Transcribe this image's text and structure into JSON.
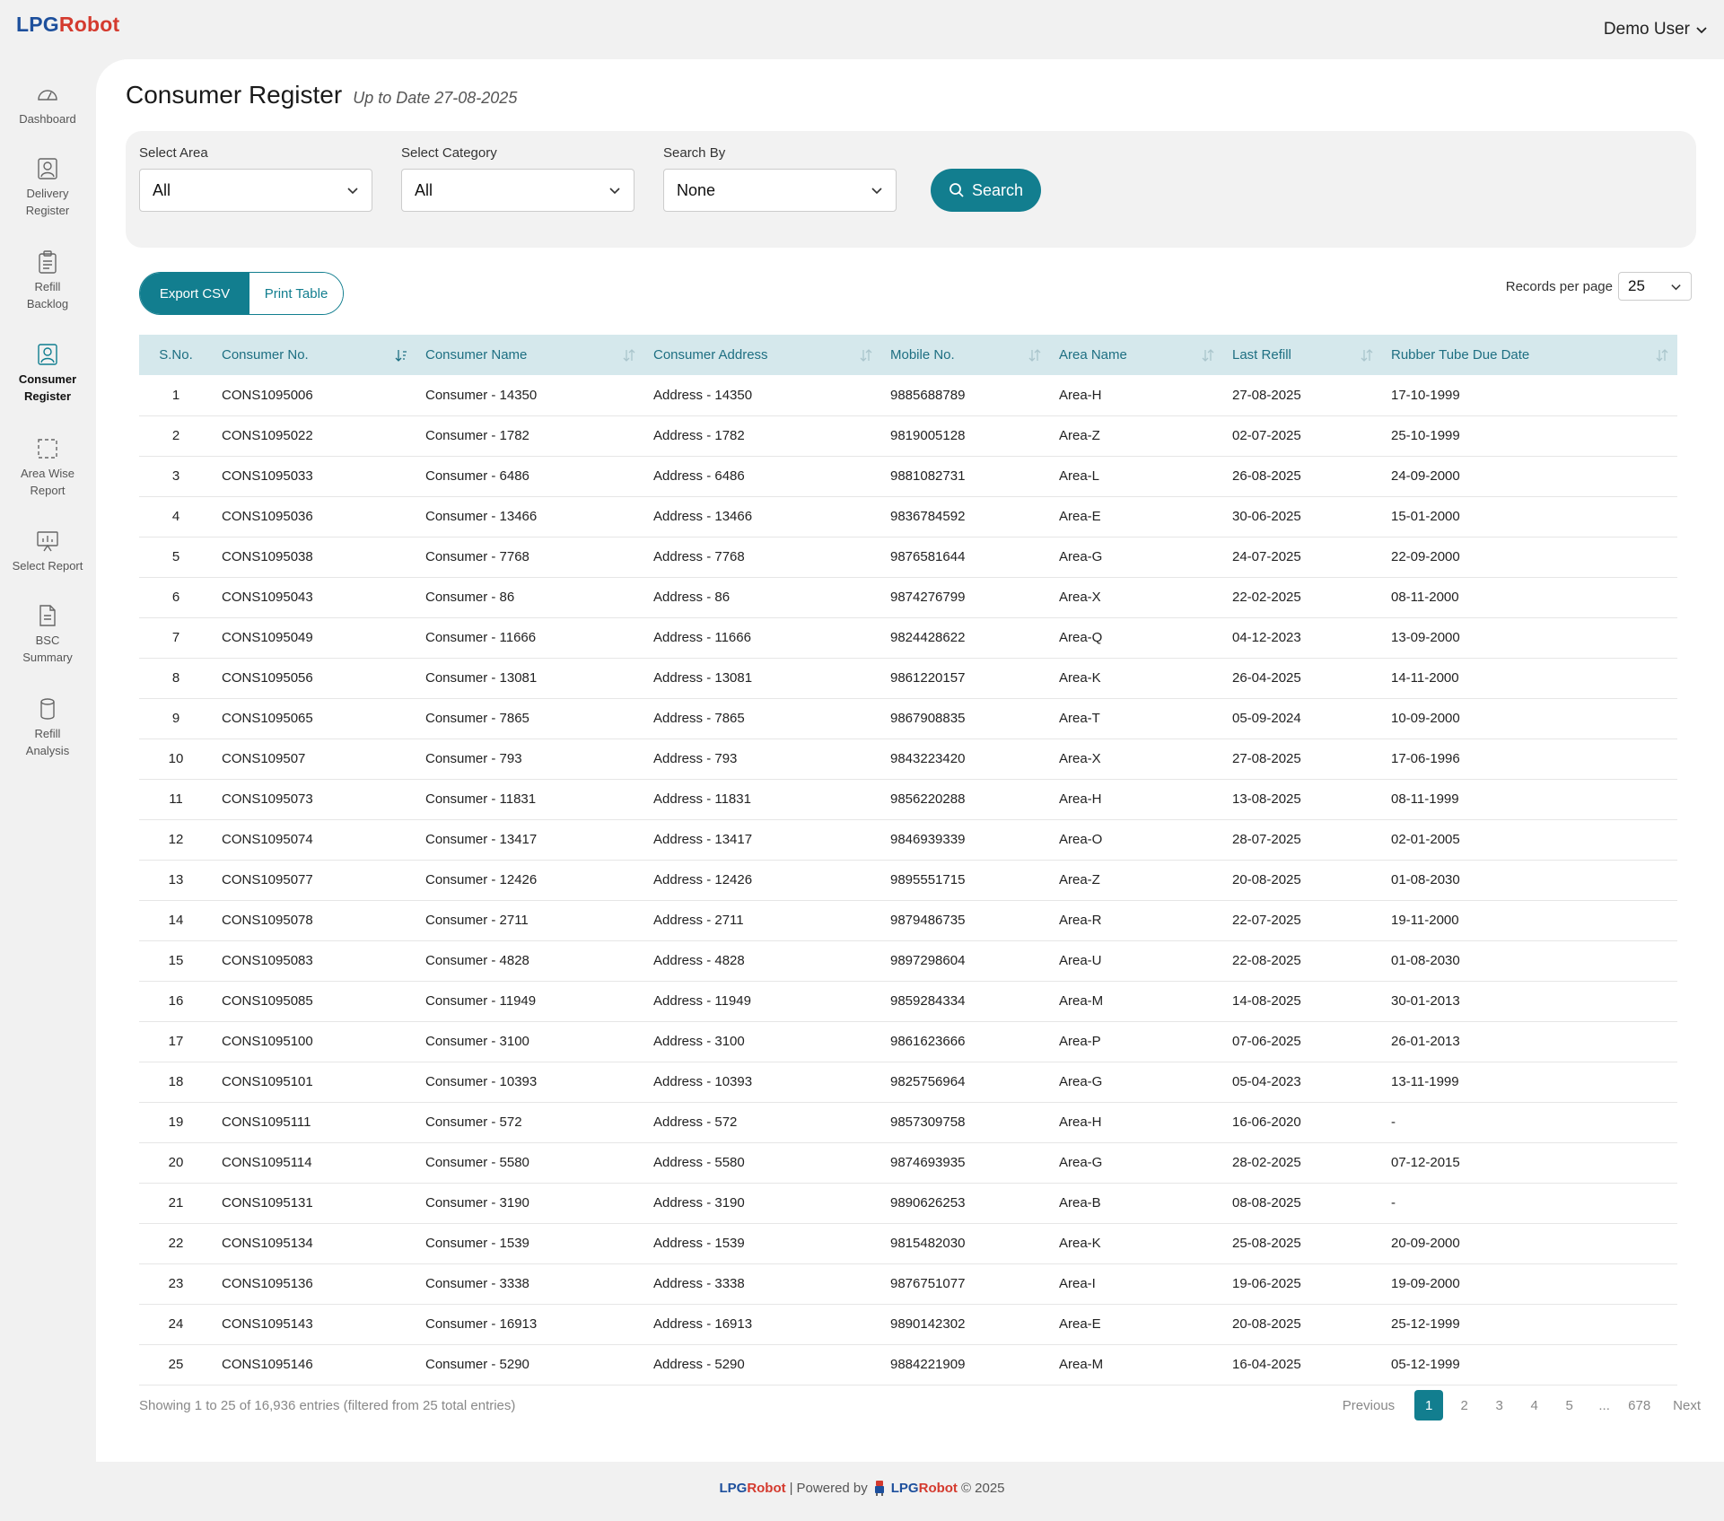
{
  "app": {
    "logo_part1": "LPG",
    "logo_part2": "Robot"
  },
  "user": {
    "name": "Demo User"
  },
  "sidebar": {
    "items": [
      {
        "line1": "Dashboard",
        "line2": ""
      },
      {
        "line1": "Delivery",
        "line2": "Register"
      },
      {
        "line1": "Refill",
        "line2": "Backlog"
      },
      {
        "line1": "Consumer",
        "line2": "Register"
      },
      {
        "line1": "Area Wise",
        "line2": "Report"
      },
      {
        "line1": "Select Report",
        "line2": ""
      },
      {
        "line1": "BSC",
        "line2": "Summary"
      },
      {
        "line1": "Refill",
        "line2": "Analysis"
      }
    ]
  },
  "page": {
    "title": "Consumer Register",
    "subtitle": "Up to Date 27-08-2025"
  },
  "filters": {
    "area_label": "Select Area",
    "area_value": "All",
    "category_label": "Select Category",
    "category_value": "All",
    "searchby_label": "Search By",
    "searchby_value": "None",
    "search_button": "Search"
  },
  "actions": {
    "export": "Export CSV",
    "print": "Print Table"
  },
  "records_per_page": {
    "label": "Records per page",
    "value": "25"
  },
  "colors": {
    "accent": "#127e8f",
    "header_bg": "#d5e8ec",
    "logo_blue": "#1d4f9c",
    "logo_red": "#d43a2e"
  },
  "table": {
    "headers": [
      "S.No.",
      "Consumer No.",
      "Consumer Name",
      "Consumer Address",
      "Mobile No.",
      "Area Name",
      "Last Refill",
      "Rubber Tube Due Date"
    ],
    "rows": [
      [
        "1",
        "CONS1095006",
        "Consumer - 14350",
        "Address - 14350",
        "9885688789",
        "Area-H",
        "27-08-2025",
        "17-10-1999"
      ],
      [
        "2",
        "CONS1095022",
        "Consumer - 1782",
        "Address - 1782",
        "9819005128",
        "Area-Z",
        "02-07-2025",
        "25-10-1999"
      ],
      [
        "3",
        "CONS1095033",
        "Consumer - 6486",
        "Address - 6486",
        "9881082731",
        "Area-L",
        "26-08-2025",
        "24-09-2000"
      ],
      [
        "4",
        "CONS1095036",
        "Consumer - 13466",
        "Address - 13466",
        "9836784592",
        "Area-E",
        "30-06-2025",
        "15-01-2000"
      ],
      [
        "5",
        "CONS1095038",
        "Consumer - 7768",
        "Address - 7768",
        "9876581644",
        "Area-G",
        "24-07-2025",
        "22-09-2000"
      ],
      [
        "6",
        "CONS1095043",
        "Consumer - 86",
        "Address - 86",
        "9874276799",
        "Area-X",
        "22-02-2025",
        "08-11-2000"
      ],
      [
        "7",
        "CONS1095049",
        "Consumer - 11666",
        "Address - 11666",
        "9824428622",
        "Area-Q",
        "04-12-2023",
        "13-09-2000"
      ],
      [
        "8",
        "CONS1095056",
        "Consumer - 13081",
        "Address - 13081",
        "9861220157",
        "Area-K",
        "26-04-2025",
        "14-11-2000"
      ],
      [
        "9",
        "CONS1095065",
        "Consumer - 7865",
        "Address - 7865",
        "9867908835",
        "Area-T",
        "05-09-2024",
        "10-09-2000"
      ],
      [
        "10",
        "CONS109507",
        "Consumer - 793",
        "Address - 793",
        "9843223420",
        "Area-X",
        "27-08-2025",
        "17-06-1996"
      ],
      [
        "11",
        "CONS1095073",
        "Consumer - 11831",
        "Address - 11831",
        "9856220288",
        "Area-H",
        "13-08-2025",
        "08-11-1999"
      ],
      [
        "12",
        "CONS1095074",
        "Consumer - 13417",
        "Address - 13417",
        "9846939339",
        "Area-O",
        "28-07-2025",
        "02-01-2005"
      ],
      [
        "13",
        "CONS1095077",
        "Consumer - 12426",
        "Address - 12426",
        "9895551715",
        "Area-Z",
        "20-08-2025",
        "01-08-2030"
      ],
      [
        "14",
        "CONS1095078",
        "Consumer - 2711",
        "Address - 2711",
        "9879486735",
        "Area-R",
        "22-07-2025",
        "19-11-2000"
      ],
      [
        "15",
        "CONS1095083",
        "Consumer - 4828",
        "Address - 4828",
        "9897298604",
        "Area-U",
        "22-08-2025",
        "01-08-2030"
      ],
      [
        "16",
        "CONS1095085",
        "Consumer - 11949",
        "Address - 11949",
        "9859284334",
        "Area-M",
        "14-08-2025",
        "30-01-2013"
      ],
      [
        "17",
        "CONS1095100",
        "Consumer - 3100",
        "Address - 3100",
        "9861623666",
        "Area-P",
        "07-06-2025",
        "26-01-2013"
      ],
      [
        "18",
        "CONS1095101",
        "Consumer - 10393",
        "Address - 10393",
        "9825756964",
        "Area-G",
        "05-04-2023",
        "13-11-1999"
      ],
      [
        "19",
        "CONS1095111",
        "Consumer - 572",
        "Address - 572",
        "9857309758",
        "Area-H",
        "16-06-2020",
        "-"
      ],
      [
        "20",
        "CONS1095114",
        "Consumer - 5580",
        "Address - 5580",
        "9874693935",
        "Area-G",
        "28-02-2025",
        "07-12-2015"
      ],
      [
        "21",
        "CONS1095131",
        "Consumer - 3190",
        "Address - 3190",
        "9890626253",
        "Area-B",
        "08-08-2025",
        "-"
      ],
      [
        "22",
        "CONS1095134",
        "Consumer - 1539",
        "Address - 1539",
        "9815482030",
        "Area-K",
        "25-08-2025",
        "20-09-2000"
      ],
      [
        "23",
        "CONS1095136",
        "Consumer - 3338",
        "Address - 3338",
        "9876751077",
        "Area-I",
        "19-06-2025",
        "19-09-2000"
      ],
      [
        "24",
        "CONS1095143",
        "Consumer - 16913",
        "Address - 16913",
        "9890142302",
        "Area-E",
        "20-08-2025",
        "25-12-1999"
      ],
      [
        "25",
        "CONS1095146",
        "Consumer - 5290",
        "Address - 5290",
        "9884221909",
        "Area-M",
        "16-04-2025",
        "05-12-1999"
      ]
    ]
  },
  "footer_info": "Showing 1 to 25 of 16,936 entries (filtered from 25 total entries)",
  "pagination": {
    "previous": "Previous",
    "pages": [
      "1",
      "2",
      "3",
      "4",
      "5",
      "...",
      "678"
    ],
    "active": "1",
    "next": "Next"
  },
  "footer": {
    "brand1": "LPG",
    "brand2": "Robot",
    "separator": "|",
    "powered_by": "Powered by",
    "brand3": "LPG",
    "brand4": "Robot",
    "copyright": "© 2025"
  }
}
